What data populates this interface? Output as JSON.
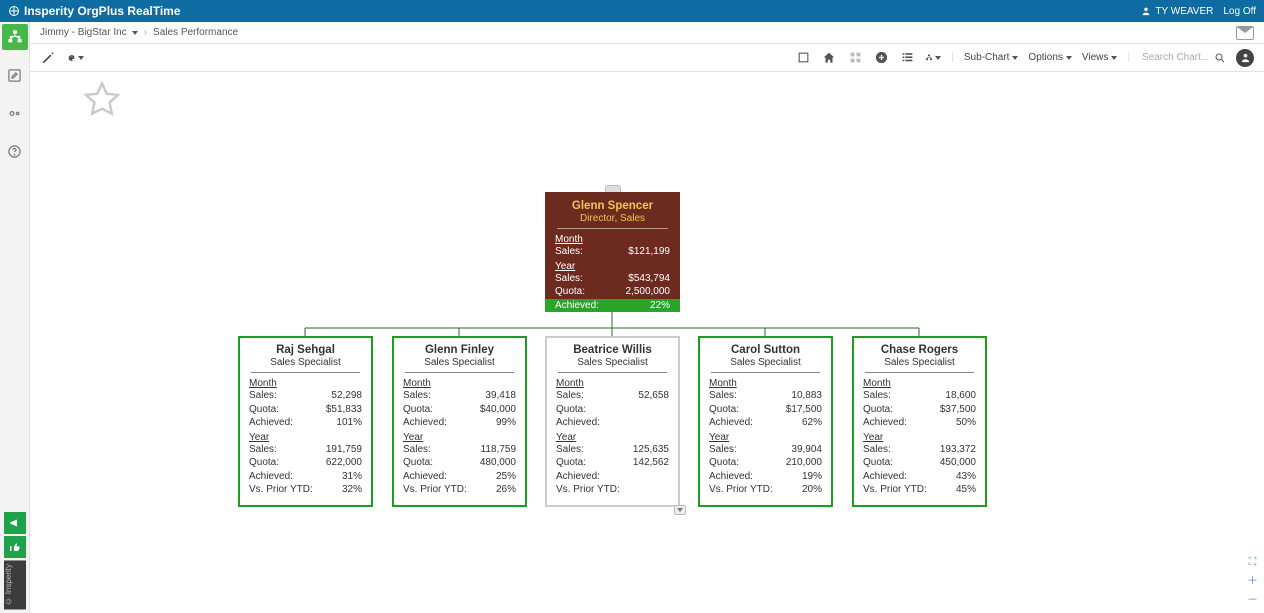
{
  "brand": "Insperity OrgPlus RealTime",
  "user": {
    "name": "TY WEAVER",
    "logoff": "Log Off"
  },
  "breadcrumb": {
    "user_ctx": "Jimmy - BigStar Inc",
    "page": "Sales Performance"
  },
  "toolbar": {
    "subchart": "Sub-Chart",
    "options": "Options",
    "views": "Views",
    "search_ph": "Search Chart..."
  },
  "copyright": "© Insperity",
  "labels": {
    "month": "Month",
    "year": "Year",
    "sales": "Sales:",
    "quota": "Quota:",
    "achieved": "Achieved:",
    "vs_py": "Vs. Prior YTD:"
  },
  "root": {
    "name": "Glenn Spencer",
    "role": "Director, Sales",
    "month_sales": "$121,199",
    "year_sales": "$543,794",
    "quota": "2,500,000",
    "achieved": "22%"
  },
  "children": [
    {
      "name": "Raj Sehgal",
      "role": "Sales Specialist",
      "month": {
        "sales": "52,298",
        "quota": "$51,833",
        "achieved": "101%"
      },
      "year": {
        "sales": "191,759",
        "quota": "622,000",
        "achieved": "31%",
        "vs_py": "32%"
      }
    },
    {
      "name": "Glenn Finley",
      "role": "Sales Specialist",
      "month": {
        "sales": "39,418",
        "quota": "$40,000",
        "achieved": "99%"
      },
      "year": {
        "sales": "118,759",
        "quota": "480,000",
        "achieved": "25%",
        "vs_py": "26%"
      }
    },
    {
      "name": "Beatrice Willis",
      "role": "Sales Specialist",
      "month": {
        "sales": "52,658",
        "quota": "",
        "achieved": ""
      },
      "year": {
        "sales": "125,635",
        "quota": "142,562",
        "achieved": "",
        "vs_py": ""
      }
    },
    {
      "name": "Carol Sutton",
      "role": "Sales Specialist",
      "month": {
        "sales": "10,883",
        "quota": "$17,500",
        "achieved": "62%"
      },
      "year": {
        "sales": "39,904",
        "quota": "210,000",
        "achieved": "19%",
        "vs_py": "20%"
      }
    },
    {
      "name": "Chase Rogers",
      "role": "Sales Specialist",
      "month": {
        "sales": "18,600",
        "quota": "$37,500",
        "achieved": "50%"
      },
      "year": {
        "sales": "193,372",
        "quota": "450,000",
        "achieved": "43%",
        "vs_py": "45%"
      }
    }
  ]
}
